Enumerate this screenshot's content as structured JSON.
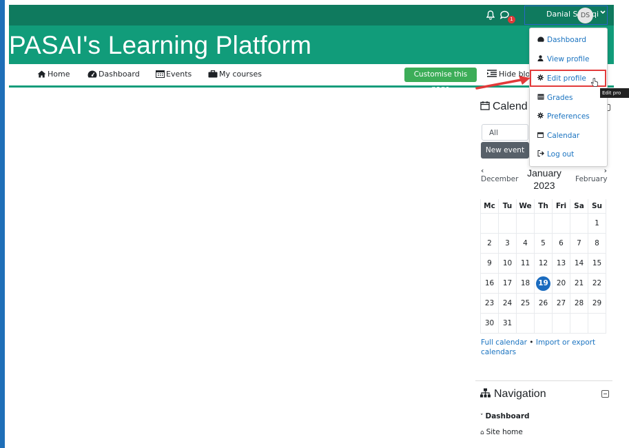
{
  "site": {
    "title": "PASAI's Learning Platform"
  },
  "user": {
    "name": "Danial Sadeqi",
    "initials": "DS",
    "message_badge": "1"
  },
  "nav": {
    "items": [
      {
        "label": "Home",
        "icon": "home-icon"
      },
      {
        "label": "Dashboard",
        "icon": "dashboard-icon"
      },
      {
        "label": "Events",
        "icon": "calendar-icon"
      },
      {
        "label": "My courses",
        "icon": "briefcase-icon"
      }
    ]
  },
  "header_actions": {
    "customise": "Customise this page",
    "hide_blocks": "Hide blo"
  },
  "user_menu": {
    "items": [
      {
        "label": "Dashboard",
        "icon": "dashboard-icon"
      },
      {
        "label": "View profile",
        "icon": "user-icon"
      },
      {
        "label": "Edit profile",
        "icon": "cog-icon"
      },
      {
        "label": "Grades",
        "icon": "table-icon"
      },
      {
        "label": "Preferences",
        "icon": "cog-icon"
      },
      {
        "label": "Calendar",
        "icon": "calendar-icon"
      },
      {
        "label": "Log out",
        "icon": "sign-out-icon"
      }
    ]
  },
  "tooltip": "Edit pro",
  "calendar": {
    "title": "Calend",
    "course_select": "All courses",
    "new_event": "New event",
    "prev_month": "December",
    "next_month": "February",
    "month": "January",
    "year": "2023",
    "weekdays": [
      "Mc",
      "Tu",
      "We",
      "Th",
      "Fri",
      "Sa",
      "Su"
    ],
    "weeks": [
      [
        "",
        "",
        "",
        "",
        "",
        "",
        "1"
      ],
      [
        "2",
        "3",
        "4",
        "5",
        "6",
        "7",
        "8"
      ],
      [
        "9",
        "10",
        "11",
        "12",
        "13",
        "14",
        "15"
      ],
      [
        "16",
        "17",
        "18",
        "19",
        "20",
        "21",
        "22"
      ],
      [
        "23",
        "24",
        "25",
        "26",
        "27",
        "28",
        "29"
      ],
      [
        "30",
        "31",
        "",
        "",
        "",
        "",
        ""
      ]
    ],
    "today": "19",
    "full_calendar": "Full calendar",
    "separator": "•",
    "import_export": "Import or export calendars"
  },
  "navigation_block": {
    "title": "Navigation",
    "dashboard": "Dashboard",
    "site_home": "Site home"
  },
  "colors": {
    "brand_dark": "#0f7a5e",
    "brand": "#119c7a",
    "customise_btn": "#3cad58",
    "link": "#1a73c0",
    "today": "#1a6bbf",
    "highlight": "#e23a3a"
  }
}
